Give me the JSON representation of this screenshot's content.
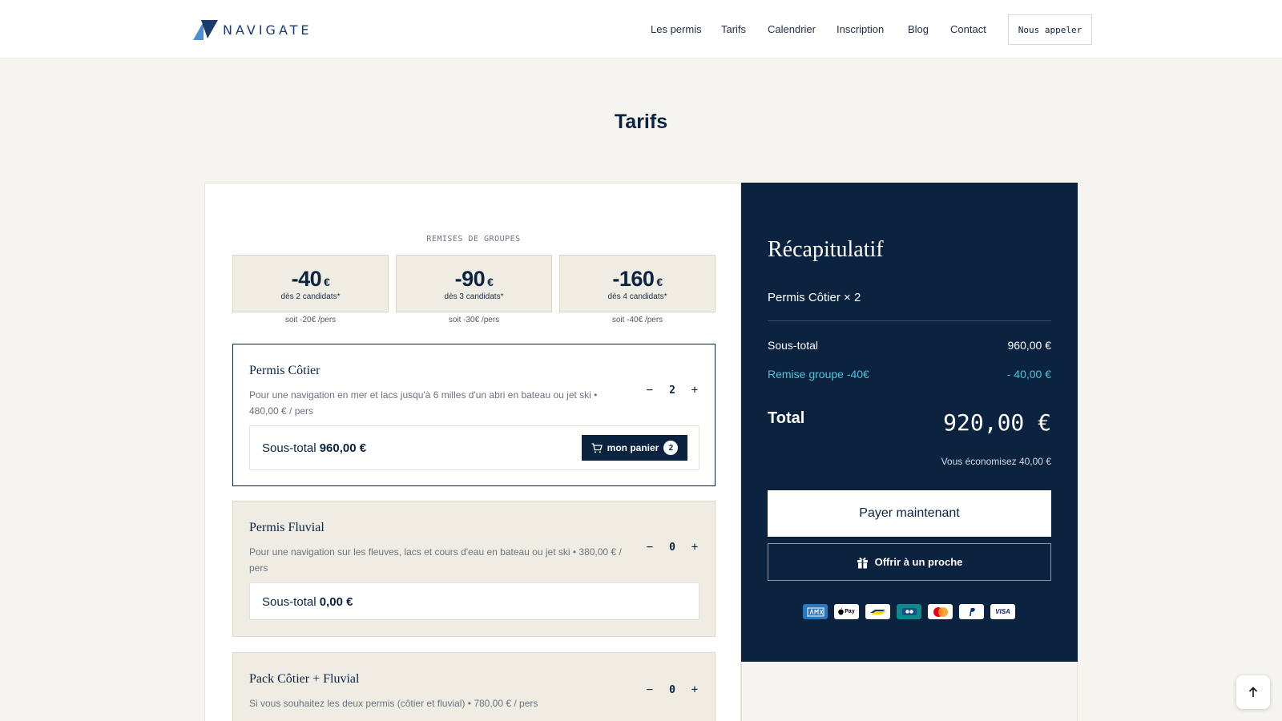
{
  "header": {
    "logo_text": "NAVIGATE",
    "nav": [
      {
        "label": "Les permis"
      },
      {
        "label": "Tarifs"
      },
      {
        "label": "Calendrier"
      },
      {
        "label": "Inscription"
      },
      {
        "label": "Blog"
      },
      {
        "label": "Contact"
      }
    ],
    "call_label": "Nous appeler"
  },
  "page": {
    "title": "Tarifs"
  },
  "remises": {
    "title": "REMISES DE GROUPES",
    "items": [
      {
        "amount": "-40",
        "currency": "€",
        "condition": "dès 2 candidats*",
        "per": "soit -20€ /pers"
      },
      {
        "amount": "-90",
        "currency": "€",
        "condition": "dès 3 candidats*",
        "per": "soit -30€ /pers"
      },
      {
        "amount": "-160",
        "currency": "€",
        "condition": "dès 4 candidats*",
        "per": "soit -40€ /pers"
      }
    ]
  },
  "products": [
    {
      "name": "Permis Côtier",
      "desc": "Pour une navigation en mer et lacs jusqu'à 6 milles d'un abri en bateau ou jet ski • 480,00 € / pers",
      "minus": "−",
      "qty": "2",
      "plus": "+",
      "subtotal_label": "Sous-total",
      "subtotal_value": "960,00 €",
      "cart_label": "mon panier",
      "cart_count": "2"
    },
    {
      "name": "Permis Fluvial",
      "desc": "Pour une navigation sur les fleuves, lacs et cours d'eau en bateau ou jet ski • 380,00 € / pers",
      "minus": "−",
      "qty": "0",
      "plus": "+",
      "subtotal_label": "Sous-total",
      "subtotal_value": "0,00 €"
    },
    {
      "name": "Pack Côtier + Fluvial",
      "desc": "Si vous souhaitez les deux permis (côtier et fluvial) • 780,00 € / pers",
      "minus": "−",
      "qty": "0",
      "plus": "+"
    }
  ],
  "summary": {
    "title": "Récapitulatif",
    "item": "Permis Côtier × 2",
    "subtotal_label": "Sous-total",
    "subtotal_value": "960,00 €",
    "discount_label": "Remise groupe -40€",
    "discount_value": "- 40,00 €",
    "total_label": "Total",
    "total_value": "920,00 €",
    "savings": "Vous économisez 40,00 €",
    "pay_label": "Payer maintenant",
    "gift_label": "Offrir à un proche",
    "payment_methods": [
      "amex",
      "apple-pay",
      "bancontact",
      "cb",
      "mastercard",
      "paypal",
      "visa"
    ],
    "visa_text": "VISA",
    "applepay_text": "Pay"
  },
  "colors": {
    "navy": "#0c2340",
    "accent_cyan": "#4fc3d9",
    "beige_bg": "#f6f4ee",
    "card_beige": "#efede3"
  }
}
